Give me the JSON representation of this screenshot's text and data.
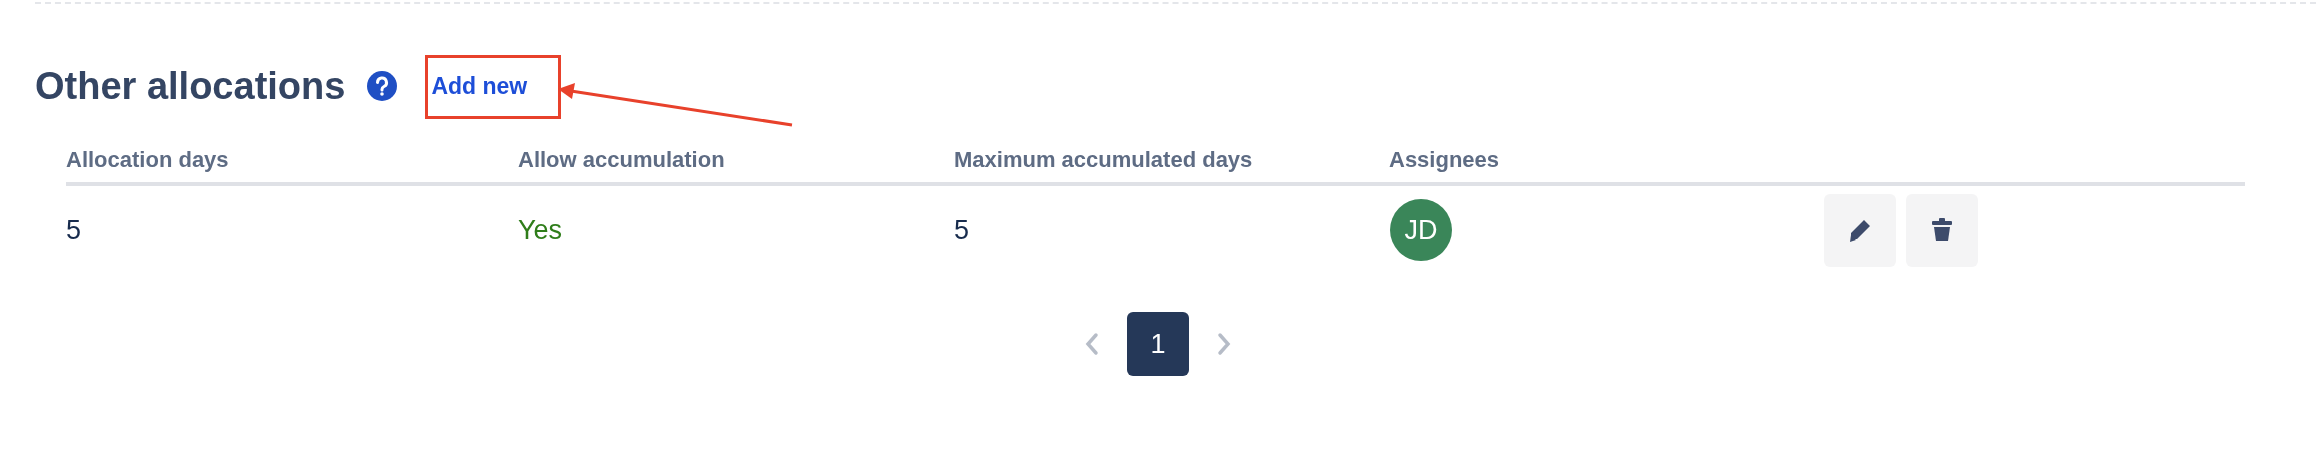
{
  "section": {
    "title": "Other allocations",
    "add_link": "Add new"
  },
  "table": {
    "columns": [
      "Allocation days",
      "Allow accumulation",
      "Maximum accumulated days",
      "Assignees"
    ],
    "rows": [
      {
        "allocation_days": "5",
        "allow_accumulation": {
          "text": "Yes",
          "enabled": true
        },
        "maximum_accumulated_days": "5",
        "assignees": [
          {
            "initials": "JD",
            "color": "#3a8659"
          }
        ]
      }
    ]
  },
  "pagination": {
    "previous": {
      "disabled": true
    },
    "pages": [
      {
        "label": "1",
        "selected": true
      }
    ],
    "next": {
      "disabled": true
    }
  }
}
